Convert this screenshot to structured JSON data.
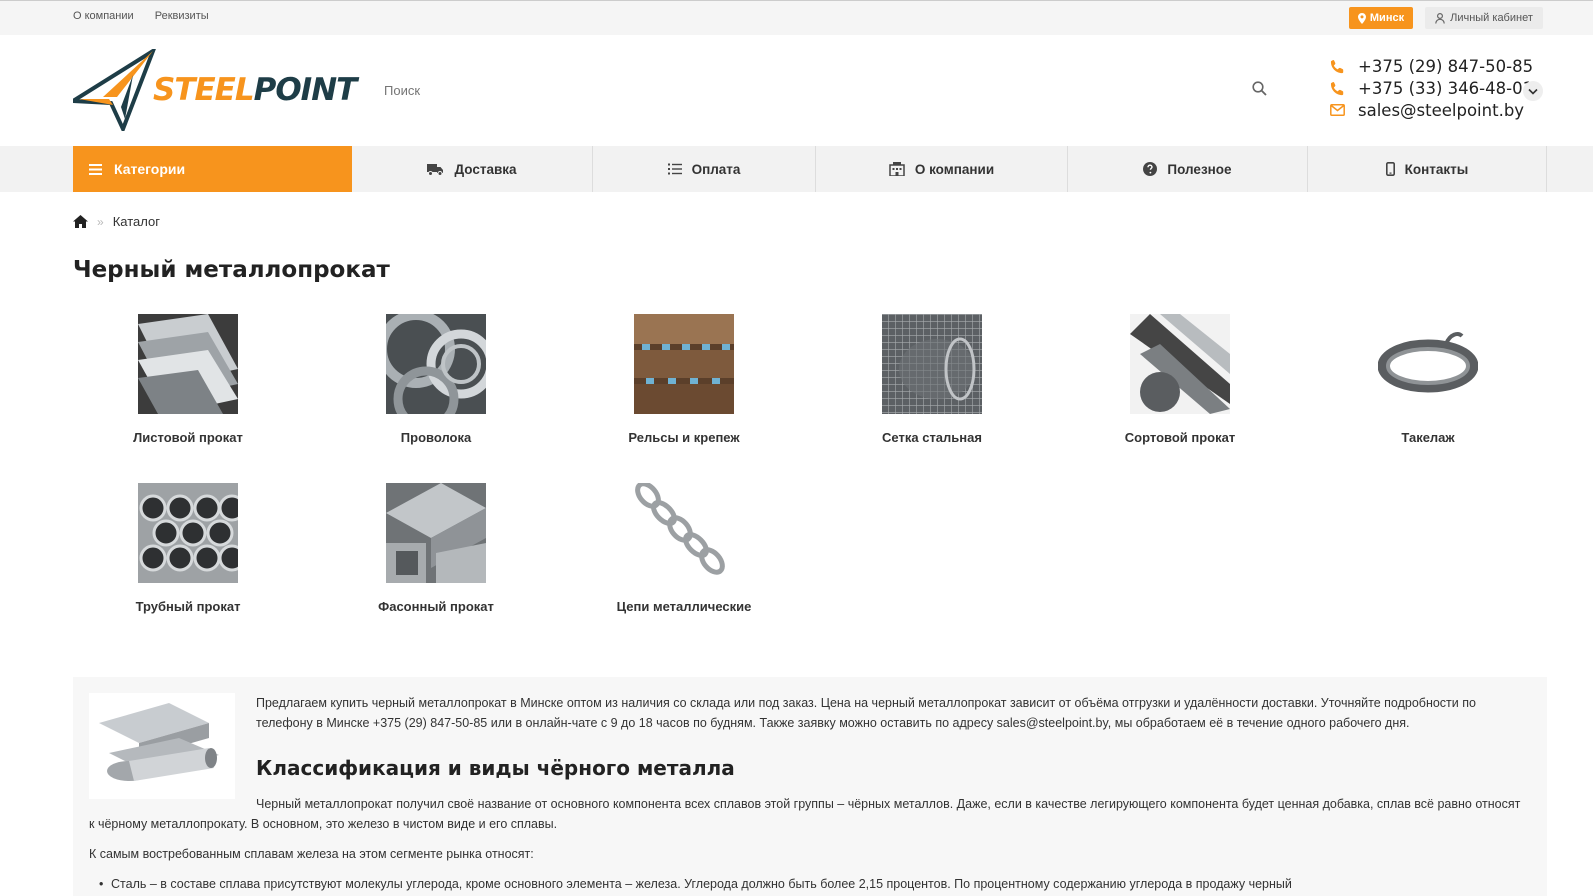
{
  "topbar": {
    "links": [
      "О компании",
      "Реквизиты"
    ],
    "city": "Минск",
    "cabinet": "Личный кабинет"
  },
  "header": {
    "logo_part1": "STEEL",
    "logo_part2": "POINT",
    "search_placeholder": "Поиск",
    "phone1": "+375 (29) 847-50-85",
    "phone2": "+375 (33) 346-48-01",
    "email": "sales@steelpoint.by"
  },
  "nav": {
    "categories": "Категории",
    "items": [
      "Доставка",
      "Оплата",
      "О компании",
      "Полезное",
      "Контакты"
    ]
  },
  "breadcrumb": {
    "current": "Каталог"
  },
  "page_title": "Черный металлопрокат",
  "categories": [
    "Листовой прокат",
    "Проволока",
    "Рельсы и крепеж",
    "Сетка стальная",
    "Сортовой прокат",
    "Такелаж",
    "Трубный прокат",
    "Фасонный прокат",
    "Цепи металлические"
  ],
  "seo": {
    "intro": "Предлагаем купить черный металлопрокат в Минске оптом из наличия со склада или под заказ. Цена на черный металлопрокат зависит от объёма отгрузки и удалённости доставки. Уточняйте подробности по телефону в Минске +375 (29) 847-50-85 или в онлайн-чате с 9 до 18 часов по будням. Также заявку можно оставить по адресу sales@steelpoint.by, мы обработаем её в течение одного рабочего дня.",
    "heading": "Классификация и виды чёрного металла",
    "para2": "Черный металлопрокат получил своё название от основного компонента всех сплавов этой группы – чёрных металлов. Даже, если в качестве легирующего компонента будет ценная добавка, сплав всё равно относят к чёрному металлопрокату. В основном, это железо в чистом виде и его сплавы.",
    "para3": "К самым востребованным сплавам железа на этом сегменте рынка относят:",
    "bullet1": "Сталь – в составе сплава присутствуют молекулы углерода, кроме основного элемента – железа. Углерода должно быть более 2,15 процентов. По процентному содержанию углерода в продажу черный"
  },
  "colors": {
    "accent": "#f7941d",
    "brand_dark": "#1e3d47"
  }
}
